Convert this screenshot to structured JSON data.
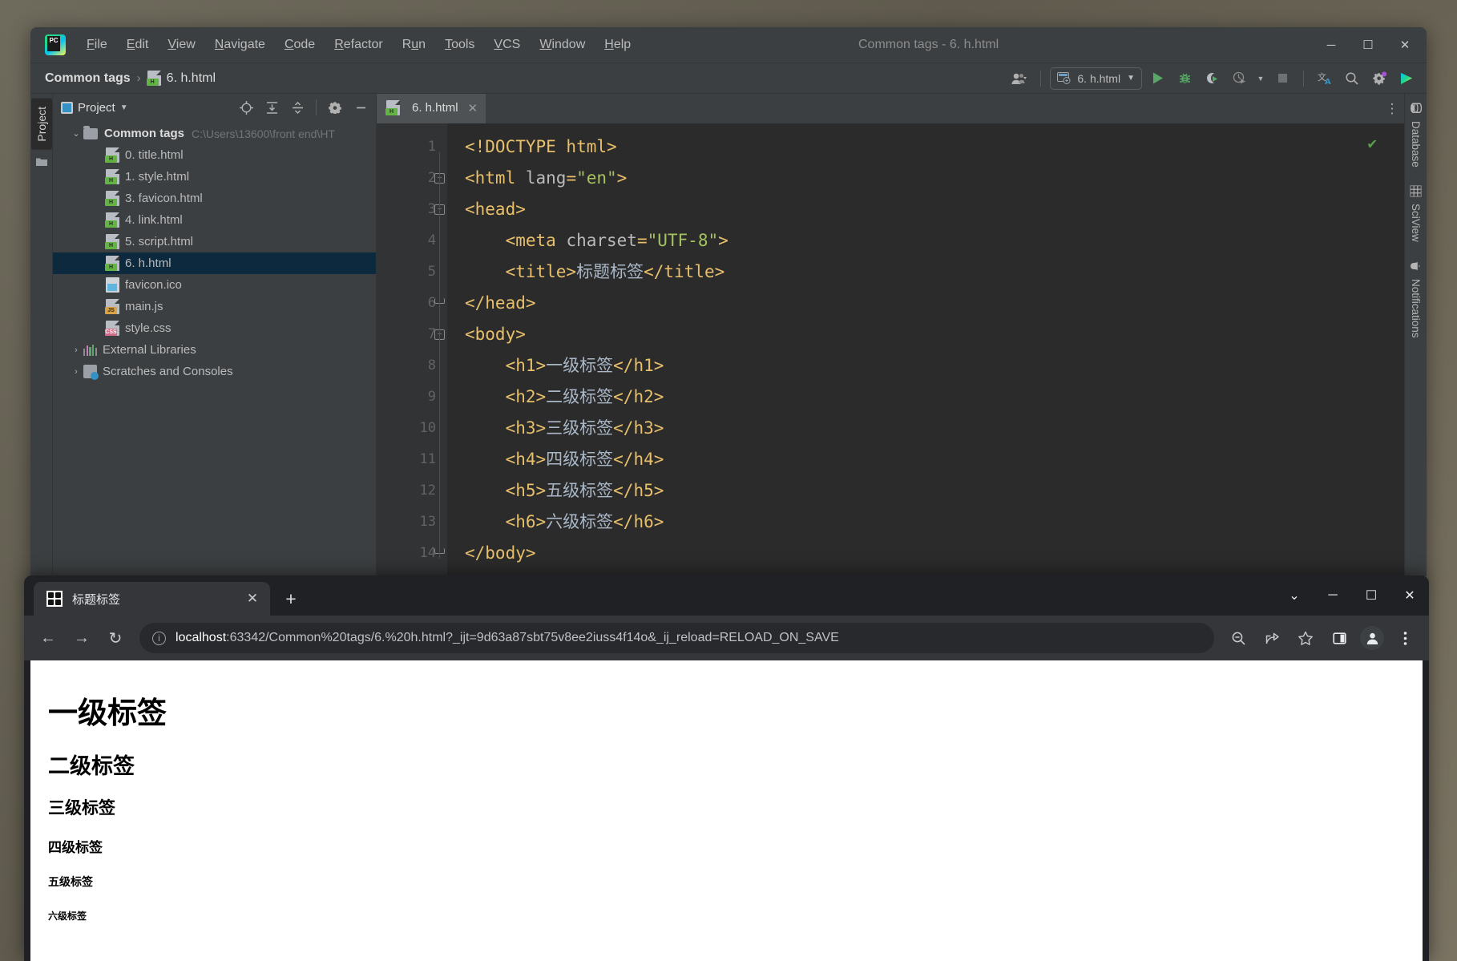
{
  "ide": {
    "window_title": "Common tags - 6. h.html",
    "logo": "pycharm-logo",
    "menu": [
      {
        "accel": "F",
        "rest": "ile"
      },
      {
        "accel": "E",
        "rest": "dit"
      },
      {
        "accel": "V",
        "rest": "iew"
      },
      {
        "accel": "N",
        "rest": "avigate"
      },
      {
        "accel": "C",
        "rest": "ode"
      },
      {
        "accel": "R",
        "rest": "efactor"
      },
      {
        "pre": "R",
        "accel": "u",
        "rest": "n"
      },
      {
        "accel": "T",
        "rest": "ools"
      },
      {
        "accel": "V",
        "rest": "CS"
      },
      {
        "accel": "W",
        "rest": "indow"
      },
      {
        "accel": "H",
        "rest": "elp"
      }
    ],
    "menu_labels": [
      "File",
      "Edit",
      "View",
      "Navigate",
      "Code",
      "Refactor",
      "Run",
      "Tools",
      "VCS",
      "Window",
      "Help"
    ],
    "window_controls": {
      "minimize": "─",
      "maximize": "☐",
      "close": "✕"
    },
    "breadcrumb": {
      "project": "Common tags",
      "separator": "›",
      "file": "6. h.html"
    },
    "run_config": {
      "name": "6. h.html",
      "dropdown": "▼"
    },
    "toolbar_icons": [
      "user-avatar-icon",
      "run-icon",
      "debug-icon",
      "run-coverage-icon",
      "profile-icon",
      "stop-icon",
      "translate-icon",
      "search-everywhere-icon",
      "settings-icon",
      "ide-helper-icon"
    ],
    "left_strip": {
      "label": "Project",
      "icon": "folder-icon"
    },
    "right_strip": [
      {
        "label": "Database",
        "icon": "database-icon"
      },
      {
        "label": "SciView",
        "icon": "grid-icon"
      },
      {
        "label": "Notifications",
        "icon": "bell-icon"
      }
    ],
    "project_panel": {
      "title": "Project",
      "dropdown": "▼",
      "actions": [
        "locate-icon",
        "expand-all-icon",
        "collapse-all-icon",
        "settings-icon",
        "hide-icon"
      ],
      "tree": [
        {
          "indent": 0,
          "arrow": "⌄",
          "icon": "folder",
          "label": "Common tags",
          "bold": true,
          "path": "C:\\Users\\13600\\front end\\HT",
          "selected": false
        },
        {
          "indent": 1,
          "arrow": "",
          "icon": "html",
          "label": "0. title.html",
          "bold": false,
          "path": "",
          "selected": false
        },
        {
          "indent": 1,
          "arrow": "",
          "icon": "html",
          "label": "1. style.html",
          "bold": false,
          "path": "",
          "selected": false
        },
        {
          "indent": 1,
          "arrow": "",
          "icon": "html",
          "label": "3. favicon.html",
          "bold": false,
          "path": "",
          "selected": false
        },
        {
          "indent": 1,
          "arrow": "",
          "icon": "html",
          "label": "4. link.html",
          "bold": false,
          "path": "",
          "selected": false
        },
        {
          "indent": 1,
          "arrow": "",
          "icon": "html",
          "label": "5. script.html",
          "bold": false,
          "path": "",
          "selected": false
        },
        {
          "indent": 1,
          "arrow": "",
          "icon": "html",
          "label": "6. h.html",
          "bold": false,
          "path": "",
          "selected": true
        },
        {
          "indent": 1,
          "arrow": "",
          "icon": "image",
          "label": "favicon.ico",
          "bold": false,
          "path": "",
          "selected": false
        },
        {
          "indent": 1,
          "arrow": "",
          "icon": "js",
          "label": "main.js",
          "bold": false,
          "path": "",
          "selected": false
        },
        {
          "indent": 1,
          "arrow": "",
          "icon": "css",
          "label": "style.css",
          "bold": false,
          "path": "",
          "selected": false
        },
        {
          "indent": 0,
          "arrow": "›",
          "icon": "lib",
          "label": "External Libraries",
          "bold": false,
          "path": "",
          "selected": false
        },
        {
          "indent": 0,
          "arrow": "›",
          "icon": "scratch",
          "label": "Scratches and Consoles",
          "bold": false,
          "path": "",
          "selected": false
        }
      ]
    },
    "editor": {
      "tab": {
        "label": "6. h.html",
        "close": "✕",
        "icon": "html-file-icon"
      },
      "more_icon": "⋮",
      "inspection_status": "✔",
      "lines": [
        {
          "n": "1",
          "fold": "",
          "indent": 0,
          "tokens": [
            {
              "t": "dtd",
              "s": "<!DOCTYPE html>"
            }
          ]
        },
        {
          "n": "2",
          "fold": "minus",
          "indent": 0,
          "tokens": [
            {
              "t": "tag",
              "s": "<html "
            },
            {
              "t": "attr",
              "s": "lang"
            },
            {
              "t": "tag",
              "s": "="
            },
            {
              "t": "val",
              "s": "\"en\""
            },
            {
              "t": "tag",
              "s": ">"
            }
          ]
        },
        {
          "n": "3",
          "fold": "minus",
          "indent": 0,
          "tokens": [
            {
              "t": "tag",
              "s": "<head>"
            }
          ]
        },
        {
          "n": "4",
          "fold": "",
          "indent": 1,
          "tokens": [
            {
              "t": "tag",
              "s": "<meta "
            },
            {
              "t": "attr",
              "s": "charset"
            },
            {
              "t": "tag",
              "s": "="
            },
            {
              "t": "val",
              "s": "\"UTF-8\""
            },
            {
              "t": "tag",
              "s": ">"
            }
          ]
        },
        {
          "n": "5",
          "fold": "",
          "indent": 1,
          "tokens": [
            {
              "t": "tag",
              "s": "<title>"
            },
            {
              "t": "txt",
              "s": "标题标签"
            },
            {
              "t": "tag",
              "s": "</title>"
            }
          ]
        },
        {
          "n": "6",
          "fold": "end",
          "indent": 0,
          "tokens": [
            {
              "t": "tag",
              "s": "</head>"
            }
          ]
        },
        {
          "n": "7",
          "fold": "minus",
          "indent": 0,
          "tokens": [
            {
              "t": "tag",
              "s": "<body>"
            }
          ]
        },
        {
          "n": "8",
          "fold": "",
          "indent": 1,
          "tokens": [
            {
              "t": "tag",
              "s": "<h1>"
            },
            {
              "t": "txt",
              "s": "一级标签"
            },
            {
              "t": "tag",
              "s": "</h1>"
            }
          ]
        },
        {
          "n": "9",
          "fold": "",
          "indent": 1,
          "tokens": [
            {
              "t": "tag",
              "s": "<h2>"
            },
            {
              "t": "txt",
              "s": "二级标签"
            },
            {
              "t": "tag",
              "s": "</h2>"
            }
          ]
        },
        {
          "n": "10",
          "fold": "",
          "indent": 1,
          "tokens": [
            {
              "t": "tag",
              "s": "<h3>"
            },
            {
              "t": "txt",
              "s": "三级标签"
            },
            {
              "t": "tag",
              "s": "</h3>"
            }
          ]
        },
        {
          "n": "11",
          "fold": "",
          "indent": 1,
          "tokens": [
            {
              "t": "tag",
              "s": "<h4>"
            },
            {
              "t": "txt",
              "s": "四级标签"
            },
            {
              "t": "tag",
              "s": "</h4>"
            }
          ]
        },
        {
          "n": "12",
          "fold": "",
          "indent": 1,
          "tokens": [
            {
              "t": "tag",
              "s": "<h5>"
            },
            {
              "t": "txt",
              "s": "五级标签"
            },
            {
              "t": "tag",
              "s": "</h5>"
            }
          ]
        },
        {
          "n": "13",
          "fold": "",
          "indent": 1,
          "tokens": [
            {
              "t": "tag",
              "s": "<h6>"
            },
            {
              "t": "txt",
              "s": "六级标签"
            },
            {
              "t": "tag",
              "s": "</h6>"
            }
          ]
        },
        {
          "n": "14",
          "fold": "end",
          "indent": 0,
          "tokens": [
            {
              "t": "tag",
              "s": "</body>"
            }
          ]
        }
      ]
    }
  },
  "browser": {
    "tab": {
      "title": "标题标签",
      "close": "✕",
      "favicon": "grid-favicon"
    },
    "new_tab": "+",
    "window_controls": {
      "more": "⌄",
      "minimize": "─",
      "maximize": "☐",
      "close": "✕"
    },
    "nav": {
      "back": "←",
      "forward": "→",
      "reload": "↻"
    },
    "omnibox": {
      "info_icon": "ⓘ",
      "host": "localhost",
      "rest": ":63342/Common%20tags/6.%20h.html?_ijt=9d63a87sbt75v8ee2iuss4f14o&_ij_reload=RELOAD_ON_SAVE",
      "full_url": "localhost:63342/Common%20tags/6.%20h.html?_ijt=9d63a87sbt75v8ee2iuss4f14o&_ij_reload=RELOAD_ON_SAVE"
    },
    "actions": [
      "zoom-out-icon",
      "share-icon",
      "bookmark-star-icon",
      "side-panel-icon",
      "profile-avatar-icon",
      "chrome-menu-icon"
    ],
    "page": {
      "h1": "一级标签",
      "h2": "二级标签",
      "h3": "三级标签",
      "h4": "四级标签",
      "h5": "五级标签",
      "h6": "六级标签"
    }
  }
}
